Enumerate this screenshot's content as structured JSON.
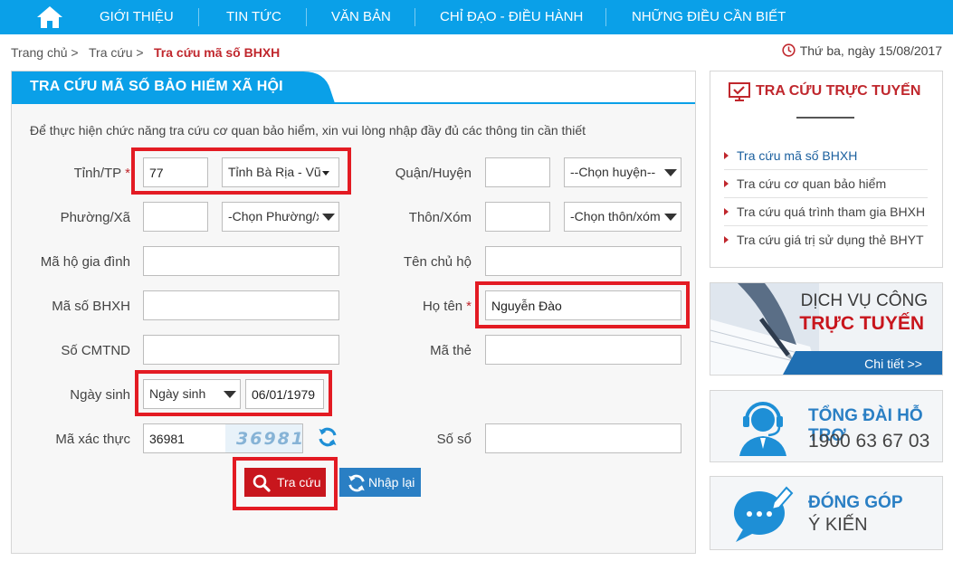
{
  "nav": {
    "home_icon": "home-icon",
    "items": [
      {
        "label": "GIỚI THIỆU"
      },
      {
        "label": "TIN TỨC"
      },
      {
        "label": "VĂN BẢN"
      },
      {
        "label": "CHỈ ĐẠO - ĐIỀU HÀNH"
      },
      {
        "label": "NHỮNG ĐIỀU CẦN BIẾT"
      }
    ]
  },
  "breadcrumb": {
    "home": "Trang chủ >",
    "section": "Tra cứu >",
    "current": "Tra cứu mã số BHXH"
  },
  "date": "Thứ ba, ngày 15/08/2017",
  "form": {
    "title": "TRA CỨU MÃ SỐ BẢO HIỂM XÃ HỘI",
    "intro": "Để thực hiện chức năng tra cứu cơ quan bảo hiểm, xin vui lòng nhập đầy đủ các thông tin cần thiết",
    "required_mark": "*",
    "province": {
      "label": "Tỉnh/TP",
      "code": "77",
      "selected": "Tỉnh Bà Rịa - Vũ"
    },
    "district": {
      "label": "Quận/Huyện",
      "code": "",
      "selected": "--Chọn huyện--"
    },
    "ward": {
      "label": "Phường/Xã",
      "code": "",
      "selected": "-Chọn Phường/xã"
    },
    "hamlet": {
      "label": "Thôn/Xóm",
      "code": "",
      "selected": "-Chọn thôn/xóm"
    },
    "household_code": {
      "label": "Mã hộ gia đình",
      "value": ""
    },
    "household_head": {
      "label": "Tên chủ hộ",
      "value": ""
    },
    "social_insurance_no": {
      "label": "Mã số BHXH",
      "value": ""
    },
    "full_name": {
      "label": "Họ tên",
      "value": "Nguyễn Đào"
    },
    "id_card": {
      "label": "Số CMTND",
      "value": ""
    },
    "card_code": {
      "label": "Mã thẻ",
      "value": ""
    },
    "birth": {
      "label": "Ngày sinh",
      "type_selected": "Ngày sinh",
      "value": "06/01/1979"
    },
    "captcha": {
      "label": "Mã xác thực",
      "value": "36981",
      "image_text": "36981"
    },
    "book_no": {
      "label": "Số sổ",
      "value": ""
    },
    "search_button": "Tra cứu",
    "reset_button": "Nhập lại"
  },
  "sidebar": {
    "title": "TRA CỨU TRỰC TUYẾN",
    "links": [
      {
        "label": "Tra cứu mã số BHXH"
      },
      {
        "label": "Tra cứu cơ quan bảo hiểm"
      },
      {
        "label": "Tra cứu quá trình tham gia BHXH"
      },
      {
        "label": "Tra cứu giá trị sử dụng thẻ BHYT"
      }
    ]
  },
  "banners": {
    "online_service": {
      "line1": "DỊCH VỤ CÔNG",
      "line2": "TRỰC TUYẾN",
      "button": "Chi tiết >>"
    },
    "hotline": {
      "title": "TỔNG ĐÀI HỖ TRỢ",
      "number": "1900 63 67 03"
    },
    "feedback": {
      "line1": "ĐÓNG GÓP",
      "line2": "Ý KIẾN"
    }
  },
  "colors": {
    "nav_bg": "#0aa0e8",
    "accent_red": "#c0272d",
    "highlight": "#e31b23",
    "button_blue": "#2a7fc4"
  }
}
